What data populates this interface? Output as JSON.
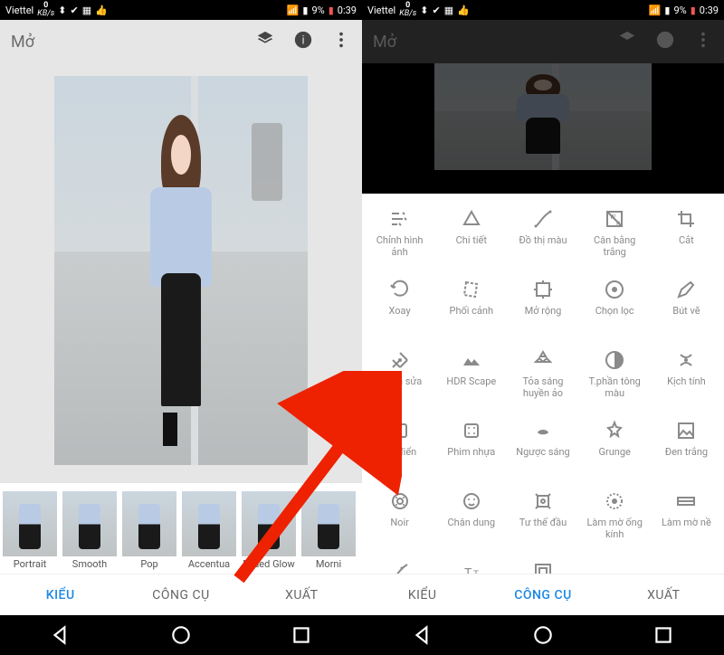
{
  "status": {
    "carrier": "Viettel",
    "data_rate": "0",
    "data_unit": "KB/s",
    "battery": "9%",
    "time": "0:39"
  },
  "screen1": {
    "title": "Mở",
    "thumbs": [
      "Portrait",
      "Smooth",
      "Pop",
      "Accentua",
      "Faded Glow",
      "Morni"
    ],
    "tabs": {
      "styles": "KIỂU",
      "tools": "CÔNG CỤ",
      "export": "XUẤT"
    },
    "active_tab": "styles"
  },
  "screen2": {
    "title": "Mở",
    "tabs": {
      "styles": "KIỂU",
      "tools": "CÔNG CỤ",
      "export": "XUẤT"
    },
    "active_tab": "tools",
    "tools": [
      "Chỉnh hình ảnh",
      "Chi tiết",
      "Đồ thị màu",
      "Cân bằng trắng",
      "Cắt",
      "Xoay",
      "Phối cảnh",
      "Mở rộng",
      "Chọn lọc",
      "Bút vẽ",
      "Chỉnh sửa",
      "HDR Scape",
      "Tỏa sáng huyền ảo",
      "T.phần tông màu",
      "Kịch tính",
      "Cổ điển",
      "Phim nhựa",
      "Ngược sáng",
      "Grunge",
      "Đen trắng",
      "Noir",
      "Chân dung",
      "Tư thế đầu",
      "Làm mờ ống kính",
      "Làm mờ nề",
      "",
      "Tт",
      "",
      "",
      ""
    ],
    "footer_icons": [
      "curves-icon",
      "text-icon",
      "frame-icon",
      "",
      ""
    ]
  }
}
